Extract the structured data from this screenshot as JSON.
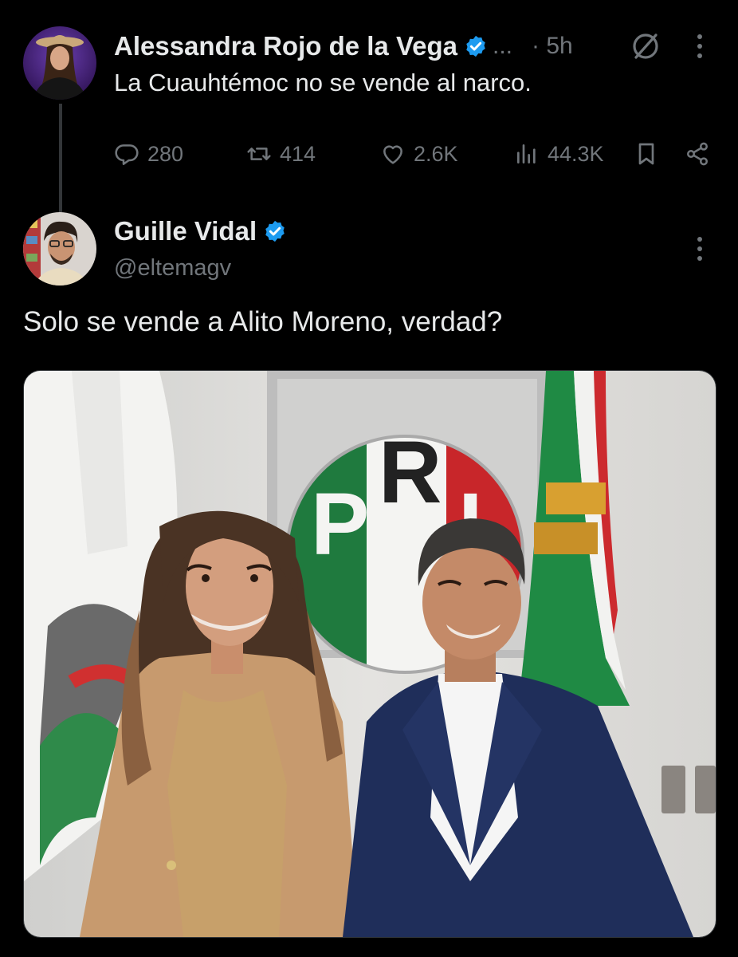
{
  "parent_tweet": {
    "author_name": "Alessandra Rojo de la Vega",
    "name_ellipsis": "...",
    "time": "· 5h",
    "text": "La Cuauhtémoc no se vende al narco.",
    "icons": [
      "verified-badge-icon",
      "grok-icon",
      "more-vertical-icon"
    ],
    "actions": {
      "replies": "280",
      "reposts": "414",
      "likes": "2.6K",
      "views": "44.3K"
    }
  },
  "reply_tweet": {
    "author_name": "Guille Vidal",
    "handle": "@eltemagv",
    "text": "Solo se vende a Alito Moreno, verdad?",
    "icons": [
      "verified-badge-icon",
      "more-vertical-icon"
    ]
  },
  "photo": {
    "logo_letters": "PRI"
  },
  "colors": {
    "background": "#000000",
    "text_primary": "#e7e9ea",
    "text_secondary": "#71767b",
    "verified_blue": "#1d9bf0",
    "thread_line": "#333639"
  }
}
